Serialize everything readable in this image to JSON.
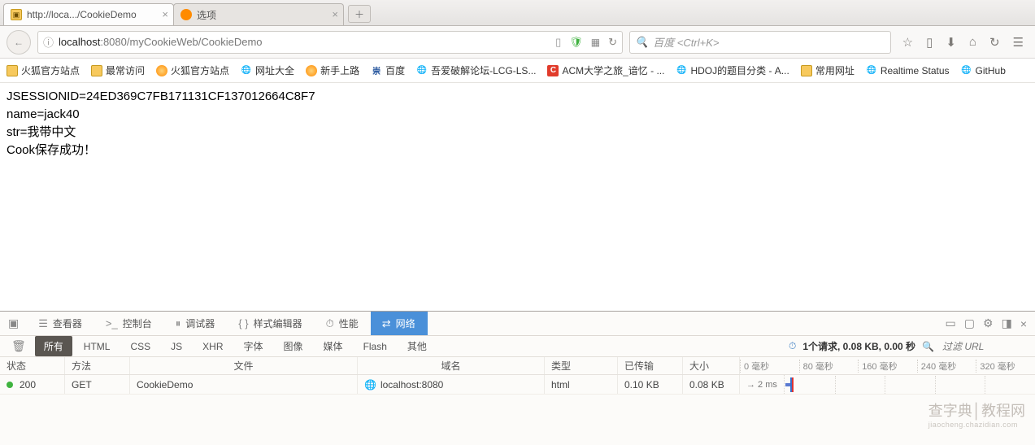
{
  "tabs": {
    "t0": {
      "title": "http://loca.../CookieDemo"
    },
    "t1": {
      "title": "选项"
    }
  },
  "url": {
    "prefix": "localhost",
    "port": ":8080",
    "rest": "/myCookieWeb/CookieDemo"
  },
  "search": {
    "placeholder": "百度 <Ctrl+K>"
  },
  "bookmarks": {
    "b0": "火狐官方站点",
    "b1": "最常访问",
    "b2": "火狐官方站点",
    "b3": "网址大全",
    "b4": "新手上路",
    "b5": "百度",
    "b6": "吾爱破解论坛-LCG-LS...",
    "b7": "ACM大学之旅_谙忆 - ...",
    "b8": "HDOJ的题目分类 - A...",
    "b9": "常用网址",
    "b10": "Realtime Status",
    "b11": "GitHub"
  },
  "page": {
    "l0": "JSESSIONID=24ED369C7FB171131CF137012664C8F7",
    "l1": "name=jack40",
    "l2": "str=我带中文",
    "l3": "Cook保存成功！"
  },
  "devtools": {
    "tabs": {
      "inspector": "查看器",
      "console": "控制台",
      "debugger": "调试器",
      "style": "样式编辑器",
      "perf": "性能",
      "net": "网络"
    },
    "filters": {
      "all": "所有",
      "html": "HTML",
      "css": "CSS",
      "js": "JS",
      "xhr": "XHR",
      "font": "字体",
      "img": "图像",
      "media": "媒体",
      "flash": "Flash",
      "other": "其他"
    },
    "summary": "1个请求, 0.08 KB, 0.00 秒",
    "filter_placeholder": "过滤 URL",
    "headers": {
      "status": "状态",
      "method": "方法",
      "file": "文件",
      "domain": "域名",
      "type": "类型",
      "xfer": "已传输",
      "size": "大小"
    },
    "ticks": {
      "t0": "0 毫秒",
      "t1": "80 毫秒",
      "t2": "160 毫秒",
      "t3": "240 毫秒",
      "t4": "320 毫秒"
    },
    "row": {
      "status": "200",
      "method": "GET",
      "file": "CookieDemo",
      "domain": "localhost:8080",
      "type": "html",
      "xfer": "0.10 KB",
      "size": "0.08 KB",
      "time": "→ 2 ms"
    }
  },
  "watermark": {
    "main": "查字典│教程网",
    "sub": "jiaocheng.chazidian.com"
  }
}
